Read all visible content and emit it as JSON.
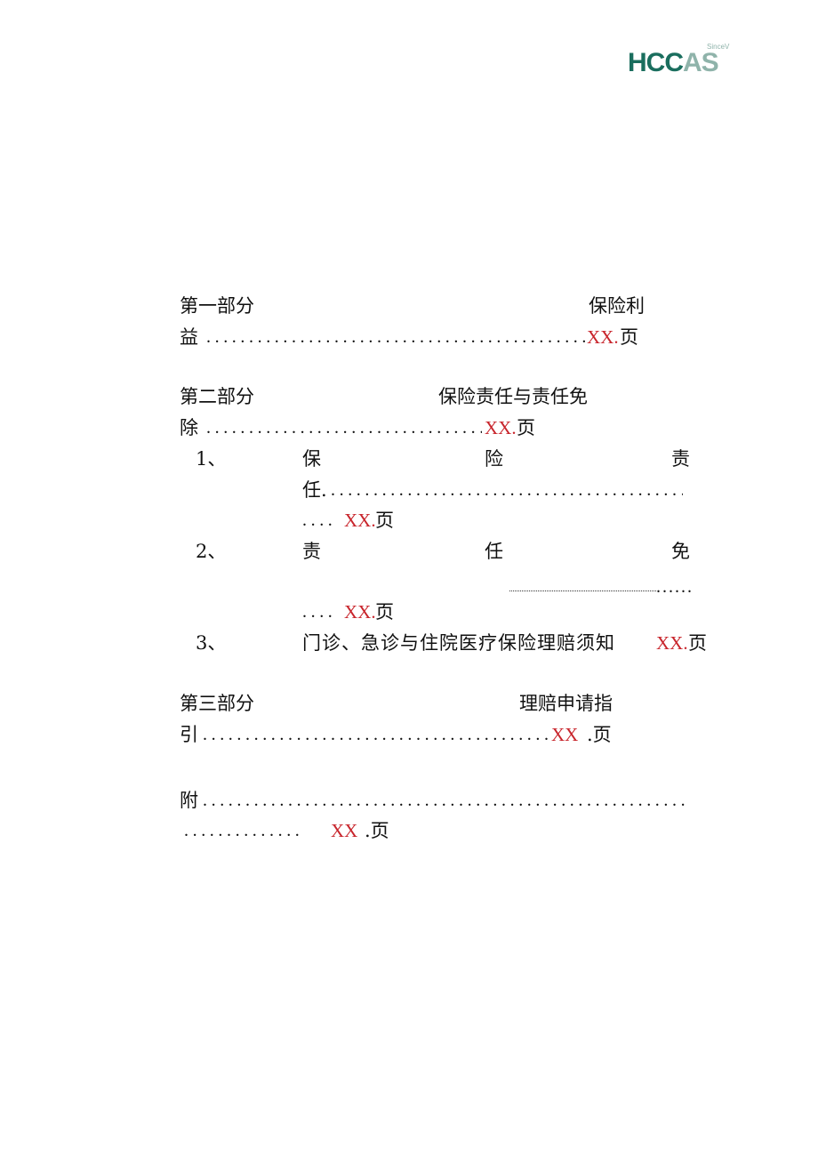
{
  "logo": {
    "text_dark": "HCC",
    "text_light": "AS",
    "tagline": "SinceV",
    "colors": {
      "dark": "#1a6e5e",
      "light": "#8fb3aa"
    }
  },
  "accent_color": "#c8252c",
  "toc": {
    "part1": {
      "label": "第一部分",
      "title": "保险利",
      "title_end": "益",
      "leader": "..........................................................",
      "page_ref": "XX.",
      "page_suffix": "页"
    },
    "part2": {
      "label": "第二部分",
      "title": "保险责任与责任免",
      "title_end": "除",
      "leader": "..........................................................",
      "page_ref": "XX.",
      "page_suffix": "页",
      "items": [
        {
          "num": "1、",
          "chars": [
            "保",
            "险",
            "责"
          ],
          "end": "任.",
          "leader": "..........................................................",
          "leader2": "....",
          "page_ref": "XX.",
          "page_suffix": "页"
        },
        {
          "num": "2、",
          "chars": [
            "责",
            "任",
            "免"
          ],
          "leader": "......",
          "leader2": "....",
          "page_ref": "XX.",
          "page_suffix": "页"
        },
        {
          "num": "3、",
          "title": "门诊、急诊与住院医疗保险理赔须知",
          "page_ref": "XX.",
          "page_suffix": "页"
        }
      ]
    },
    "part3": {
      "label": "第三部分",
      "title": "理赔申请指",
      "title_end": "引",
      "leader": "..........................................................",
      "page_ref": "XX",
      "page_suffix": ".页"
    },
    "appendix": {
      "title": "附",
      "leader": "..........................................................",
      "leader2": "..............",
      "page_ref": "XX",
      "page_suffix": ".页"
    }
  }
}
